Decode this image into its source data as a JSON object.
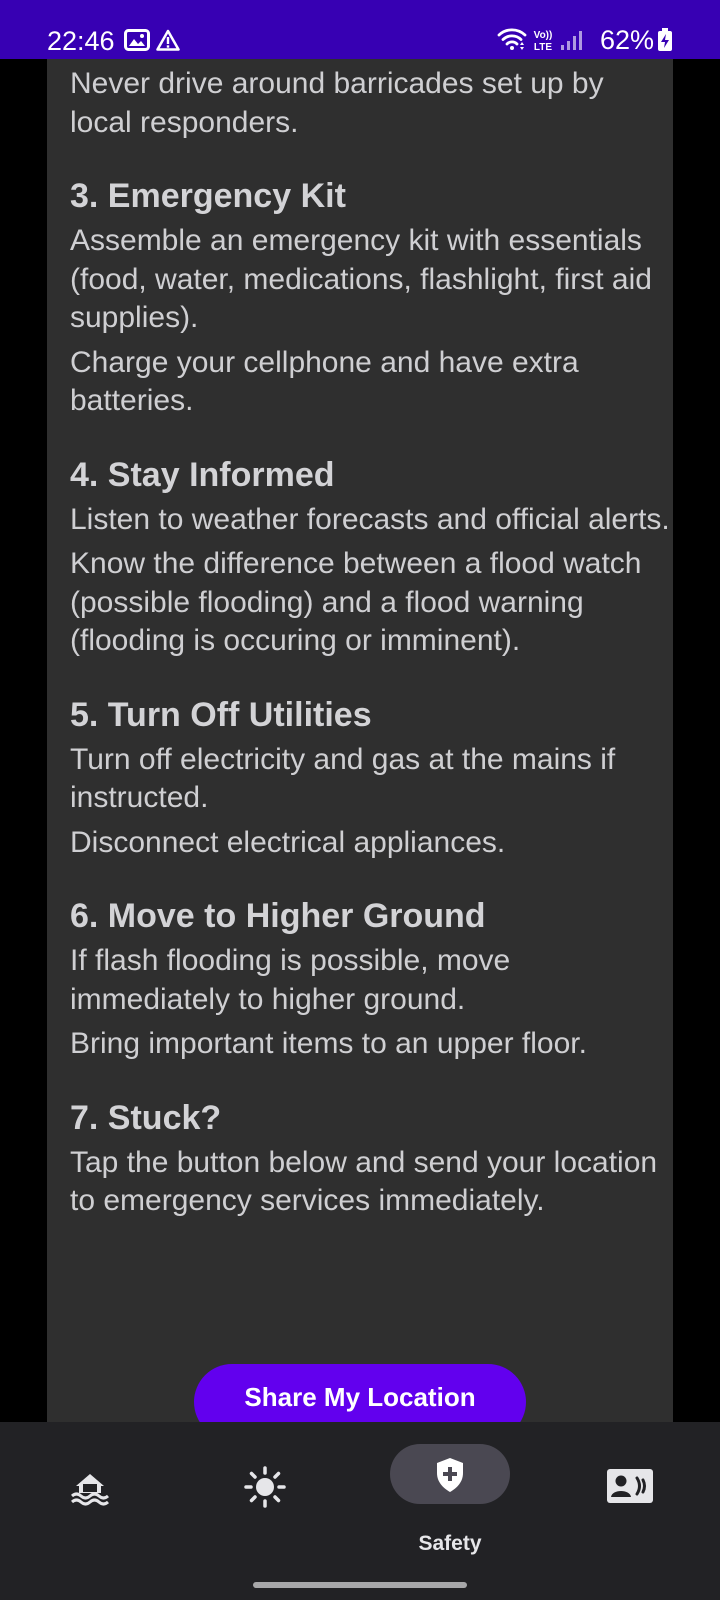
{
  "status_bar": {
    "time": "22:46",
    "battery": "62%",
    "network_label_top": "Vo))",
    "network_label_bottom": "LTE",
    "icons": [
      "image-icon",
      "warning-icon",
      "wifi-icon",
      "volte-icon",
      "signal-icon",
      "battery-charging-icon"
    ]
  },
  "content": {
    "intro_paragraph": "Never drive around barricades set up by local responders.",
    "sections": [
      {
        "title": "3. Emergency Kit",
        "paragraphs": [
          "Assemble an emergency kit with essentials (food, water, medications, flashlight, first aid supplies).",
          "Charge your cellphone and have extra batteries."
        ]
      },
      {
        "title": "4. Stay Informed",
        "paragraphs": [
          "Listen to weather forecasts and official alerts.",
          "Know the difference between a flood watch (possible flooding) and a flood warning (flooding is occuring or imminent)."
        ]
      },
      {
        "title": "5. Turn Off Utilities",
        "paragraphs": [
          "Turn off electricity and gas at the mains if instructed.",
          "Disconnect electrical appliances."
        ]
      },
      {
        "title": "6. Move to Higher Ground",
        "paragraphs": [
          "If flash flooding is possible, move immediately to higher ground.",
          "Bring important items to an upper floor."
        ]
      },
      {
        "title": "7. Stuck?",
        "paragraphs": [
          "Tap the button below and send your location to emergency services immediately."
        ]
      }
    ],
    "share_button_label": "Share My Location"
  },
  "bottom_nav": {
    "items": [
      {
        "icon": "flood-house-icon",
        "label": "",
        "active": false
      },
      {
        "icon": "sun-icon",
        "label": "",
        "active": false
      },
      {
        "icon": "shield-plus-icon",
        "label": "Safety",
        "active": true
      },
      {
        "icon": "contact-card-icon",
        "label": "",
        "active": false
      }
    ]
  },
  "colors": {
    "status_bar": "#3700b3",
    "card_background": "#2f2f2f",
    "body_text": "#cfcfd2",
    "accent_button": "#6200ee",
    "nav_background": "#222225",
    "active_pill": "#4a4852"
  }
}
